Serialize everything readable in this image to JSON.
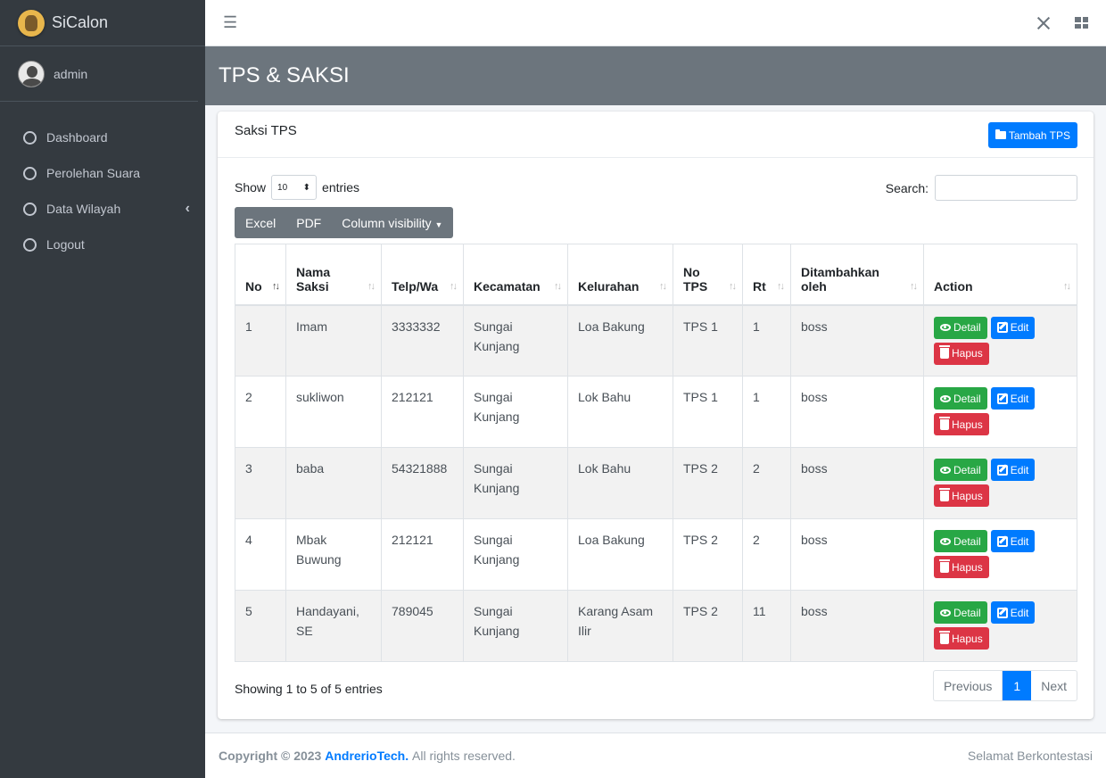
{
  "app": {
    "brand": "SiCalon",
    "user": "admin"
  },
  "sidebar": {
    "items": [
      {
        "label": "Dashboard"
      },
      {
        "label": "Perolehan Suara"
      },
      {
        "label": "Data Wilayah"
      },
      {
        "label": "Logout"
      }
    ]
  },
  "page": {
    "title": "TPS & SAKSI"
  },
  "card": {
    "title": "Saksi TPS",
    "add_label": "Tambah TPS"
  },
  "controls": {
    "show_label": "Show",
    "entries_label": "entries",
    "length_value": "10",
    "search_label": "Search:",
    "search_value": ""
  },
  "toolbar": {
    "excel": "Excel",
    "pdf": "PDF",
    "column_visibility": "Column visibility"
  },
  "table": {
    "headers": {
      "no": "No",
      "nama": "Nama Saksi",
      "telp": "Telp/Wa",
      "kecamatan": "Kecamatan",
      "kelurahan": "Kelurahan",
      "no_tps": "No TPS",
      "rt": "Rt",
      "ditambahkan": "Ditambahkan oleh",
      "action": "Action"
    },
    "rows": [
      {
        "no": "1",
        "nama": "Imam",
        "telp": "3333332",
        "kecamatan": "Sungai Kunjang",
        "kelurahan": "Loa Bakung",
        "no_tps": "TPS 1",
        "rt": "1",
        "ditambahkan": "boss"
      },
      {
        "no": "2",
        "nama": "sukliwon",
        "telp": "212121",
        "kecamatan": "Sungai Kunjang",
        "kelurahan": "Lok Bahu",
        "no_tps": "TPS 1",
        "rt": "1",
        "ditambahkan": "boss"
      },
      {
        "no": "3",
        "nama": "baba",
        "telp": "54321888",
        "kecamatan": "Sungai Kunjang",
        "kelurahan": "Lok Bahu",
        "no_tps": "TPS 2",
        "rt": "2",
        "ditambahkan": "boss"
      },
      {
        "no": "4",
        "nama": "Mbak Buwung",
        "telp": "212121",
        "kecamatan": "Sungai Kunjang",
        "kelurahan": "Loa Bakung",
        "no_tps": "TPS 2",
        "rt": "2",
        "ditambahkan": "boss"
      },
      {
        "no": "5",
        "nama": "Handayani, SE",
        "telp": "789045",
        "kecamatan": "Sungai Kunjang",
        "kelurahan": "Karang Asam Ilir",
        "no_tps": "TPS 2",
        "rt": "11",
        "ditambahkan": "boss"
      }
    ],
    "actions": {
      "detail": "Detail",
      "edit": "Edit",
      "hapus": "Hapus"
    }
  },
  "pagination": {
    "info": "Showing 1 to 5 of 5 entries",
    "previous": "Previous",
    "current": "1",
    "next": "Next"
  },
  "footer": {
    "copyright": "Copyright © 2023",
    "brand": "AndrerioTech.",
    "rights": "All rights reserved.",
    "right_text": "Selamat Berkontestasi"
  },
  "colors": {
    "primary": "#007bff",
    "success": "#28a745",
    "danger": "#dc3545",
    "sidebar": "#343a40",
    "header": "#6c757d"
  }
}
